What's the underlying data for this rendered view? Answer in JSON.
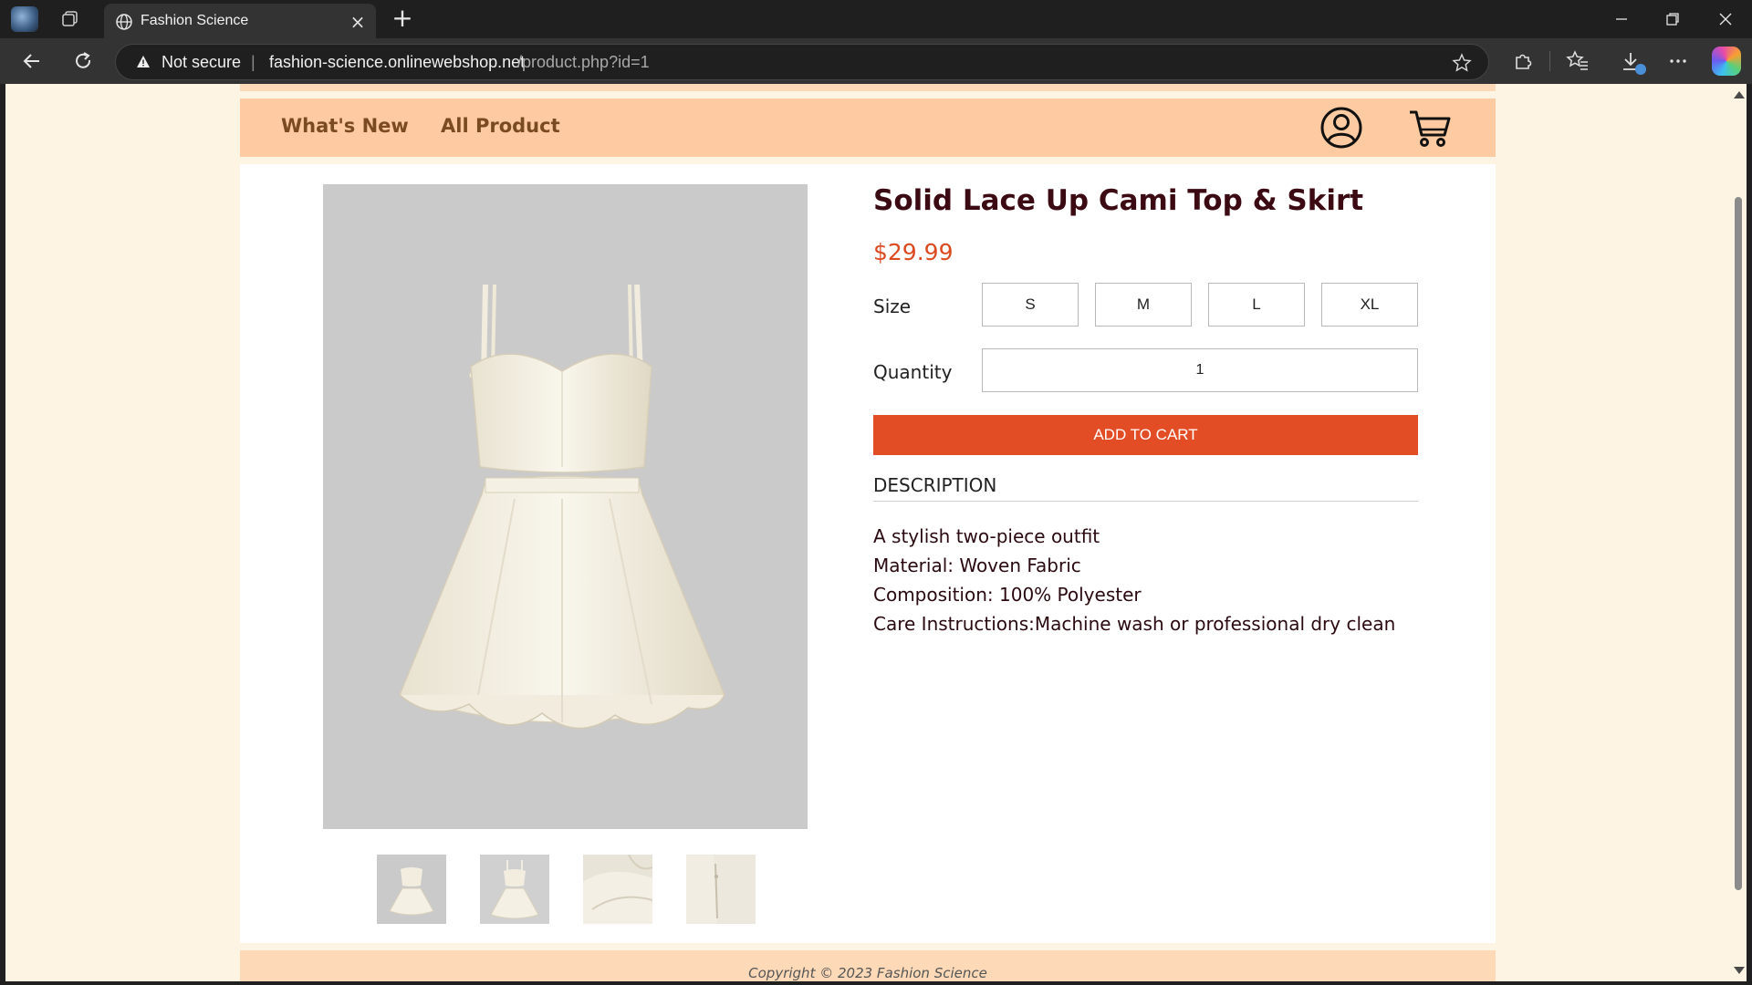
{
  "browser": {
    "tab_title": "Fashion Science",
    "security_label": "Not secure",
    "url_separator": "|",
    "url_host": "fashion-science.onlinewebshop.net",
    "url_path": "/product.php?id=1",
    "icons": [
      "profile-icon",
      "workspaces-icon",
      "globe-icon",
      "close-icon",
      "plus-icon",
      "minimize-icon",
      "restore-icon",
      "close-window-icon",
      "back-arrow-icon",
      "reload-icon",
      "warning-icon",
      "star-icon",
      "extensions-icon",
      "favorites-icon",
      "download-icon",
      "more-icon",
      "copilot-icon"
    ]
  },
  "site": {
    "nav": {
      "whats_new": "What's New",
      "all_product": "All Product",
      "icons": [
        "account-icon",
        "cart-icon"
      ]
    },
    "footer": "Copyright © 2023 Fashion Science",
    "colors": {
      "page_bg": "#fdf4e4",
      "nav_bg": "#fdcaa1",
      "nav_text": "#7a4a20",
      "accent": "#e24d26",
      "price": "#dc4a22",
      "title": "#3b0a12"
    }
  },
  "product": {
    "title": "Solid Lace Up Cami Top & Skirt",
    "price": "$29.99",
    "size_label": "Size",
    "sizes": [
      "S",
      "M",
      "L",
      "XL"
    ],
    "quantity_label": "Quantity",
    "quantity": "1",
    "add_to_cart": "ADD TO CART",
    "description_heading": "DESCRIPTION",
    "description": [
      "A stylish two-piece outfit",
      "Material: Woven Fabric",
      "Composition: 100% Polyester",
      "Care Instructions:Machine wash or professional dry clean"
    ],
    "thumbnail_count": 4
  }
}
